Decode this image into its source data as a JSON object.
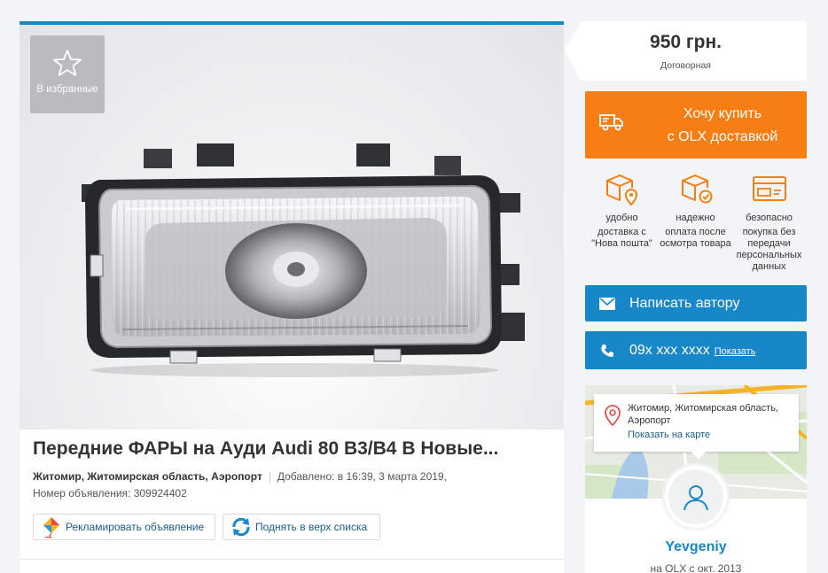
{
  "listing": {
    "favorite_label": "В избранные",
    "title": "Передние ФАРЫ на Ауди Audi 80 B3/B4 В Новые...",
    "location": "Житомир, Житомирская область, Аэропорт",
    "added": "Добавлено: в 16:39, 3 марта 2019,",
    "ad_number": "Номер объявления: 309924402",
    "promote_label": "Рекламировать объявление",
    "raise_label": "Поднять в верх списка"
  },
  "price": {
    "amount": "950 грн.",
    "note": "Договорная"
  },
  "buy": {
    "line1": "Хочу купить",
    "line2": "с OLX доставкой"
  },
  "benefits": [
    {
      "head": "удобно",
      "text": "доставка с \"Нова пошта\"",
      "icon": "box-location-icon"
    },
    {
      "head": "надежно",
      "text": "оплата после осмотра товара",
      "icon": "box-check-icon"
    },
    {
      "head": "безопасно",
      "text": "покупка без передачи персональных данных",
      "icon": "card-icon"
    }
  ],
  "contact": {
    "message_label": "Написать автору",
    "phone": "09x xxx xxxx",
    "show_label": "Показать"
  },
  "map": {
    "address": "Житомир, Житомирская область, Аэропорт",
    "show_on_map": "Показать на карте"
  },
  "user": {
    "name": "Yevgeniy",
    "since": "на OLX с окт. 2013"
  },
  "colors": {
    "accent_blue": "#1887c7",
    "orange": "#f67e12",
    "background": "#f2f4f5"
  }
}
